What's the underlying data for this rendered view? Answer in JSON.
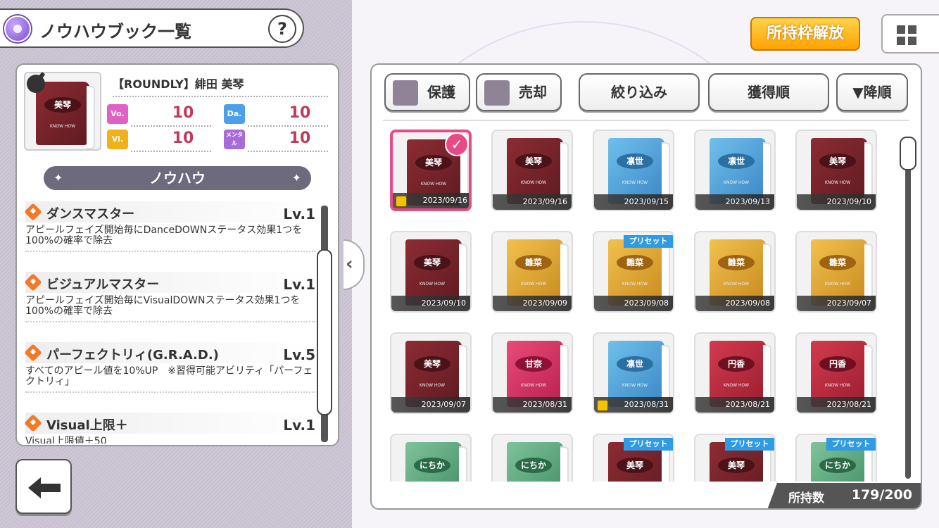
{
  "header": {
    "title": "ノウハウブック一覧",
    "help": "?"
  },
  "selected": {
    "name": "【ROUNDLY】緋田 美琴",
    "cover_label": "美琴",
    "stats": [
      {
        "badge": "Vo.",
        "value": "10",
        "color": "#e25fc4"
      },
      {
        "badge": "Da.",
        "value": "10",
        "color": "#4c9fe8"
      },
      {
        "badge": "Vi.",
        "value": "10",
        "color": "#f0b11b"
      },
      {
        "badge": "メンタル",
        "value": "10",
        "color": "#a86cd8"
      }
    ],
    "section_title": "ノウハウ",
    "skills": [
      {
        "name": "ダンスマスター",
        "level": "Lv.1",
        "desc": "アピールフェイズ開始毎にDanceDOWNステータス効果1つを100%の確率で除去"
      },
      {
        "name": "ビジュアルマスター",
        "level": "Lv.1",
        "desc": "アピールフェイズ開始毎にVisualDOWNステータス効果1つを100%の確率で除去"
      },
      {
        "name": "パーフェクトリィ(G.R.A.D.)",
        "level": "Lv.5",
        "desc": "すべてのアピール値を10%UP　※習得可能アビリティ「パーフェクトリィ」"
      },
      {
        "name": "Visual上限＋",
        "level": "Lv.1",
        "desc": "Visual上限値＋50"
      }
    ]
  },
  "top_right": {
    "unlock_label": "所持枠解放"
  },
  "toolbar": {
    "protect_label": "保護",
    "sell_label": "売却",
    "filter_label": "絞り込み",
    "sort_label": "獲得順",
    "order_label": "▼降順"
  },
  "books": [
    {
      "label": "美琴",
      "color": "red",
      "date": "2023/09/16",
      "locked": true,
      "selected": true,
      "preset": false
    },
    {
      "label": "美琴",
      "color": "red",
      "date": "2023/09/16",
      "locked": false,
      "selected": false,
      "preset": false
    },
    {
      "label": "凛世",
      "color": "blue",
      "date": "2023/09/15",
      "locked": false,
      "selected": false,
      "preset": false
    },
    {
      "label": "凛世",
      "color": "blue",
      "date": "2023/09/13",
      "locked": false,
      "selected": false,
      "preset": false
    },
    {
      "label": "美琴",
      "color": "red",
      "date": "2023/09/10",
      "locked": false,
      "selected": false,
      "preset": false
    },
    {
      "label": "美琴",
      "color": "red",
      "date": "2023/09/10",
      "locked": false,
      "selected": false,
      "preset": false
    },
    {
      "label": "雛菜",
      "color": "gold",
      "date": "2023/09/09",
      "locked": false,
      "selected": false,
      "preset": false
    },
    {
      "label": "雛菜",
      "color": "gold",
      "date": "2023/09/08",
      "locked": false,
      "selected": false,
      "preset": true
    },
    {
      "label": "雛菜",
      "color": "gold",
      "date": "2023/09/08",
      "locked": false,
      "selected": false,
      "preset": false
    },
    {
      "label": "雛菜",
      "color": "gold",
      "date": "2023/09/07",
      "locked": false,
      "selected": false,
      "preset": false
    },
    {
      "label": "美琴",
      "color": "red",
      "date": "2023/09/07",
      "locked": false,
      "selected": false,
      "preset": false
    },
    {
      "label": "甘奈",
      "color": "pink",
      "date": "2023/08/31",
      "locked": false,
      "selected": false,
      "preset": false
    },
    {
      "label": "凛世",
      "color": "blue",
      "date": "2023/08/31",
      "locked": true,
      "selected": false,
      "preset": false
    },
    {
      "label": "円香",
      "color": "crimson",
      "date": "2023/08/21",
      "locked": false,
      "selected": false,
      "preset": false
    },
    {
      "label": "円香",
      "color": "crimson",
      "date": "2023/08/21",
      "locked": false,
      "selected": false,
      "preset": false
    },
    {
      "label": "にちか",
      "color": "green",
      "date": "",
      "locked": false,
      "selected": false,
      "preset": false
    },
    {
      "label": "にちか",
      "color": "green",
      "date": "",
      "locked": false,
      "selected": false,
      "preset": false
    },
    {
      "label": "美琴",
      "color": "red",
      "date": "",
      "locked": false,
      "selected": false,
      "preset": true
    },
    {
      "label": "美琴",
      "color": "red",
      "date": "",
      "locked": false,
      "selected": false,
      "preset": true
    },
    {
      "label": "にちか",
      "color": "green",
      "date": "",
      "locked": false,
      "selected": false,
      "preset": true
    }
  ],
  "book_sub": "KNOW HOW",
  "preset_label": "プリセット",
  "footer": {
    "count_label": "所持数",
    "count_value": "179/200"
  }
}
